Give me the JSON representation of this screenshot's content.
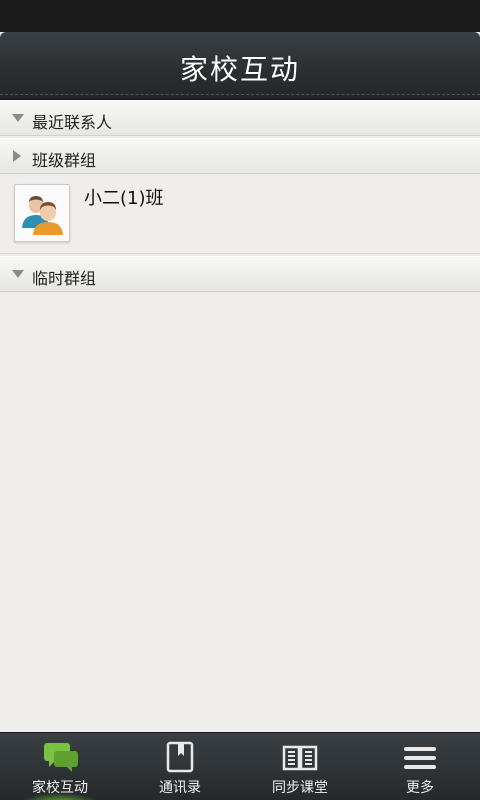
{
  "header": {
    "title": "家校互动"
  },
  "groups": [
    {
      "label": "最近联系人",
      "expanded": true
    },
    {
      "label": "班级群组",
      "expanded": false
    },
    {
      "label": "临时群组",
      "expanded": true
    }
  ],
  "contacts": [
    {
      "name": "小二(1)班",
      "icon": "group-avatar-icon"
    }
  ],
  "tabs": [
    {
      "label": "家校互动",
      "icon": "chat-bubbles-icon",
      "active": true
    },
    {
      "label": "通讯录",
      "icon": "address-book-icon",
      "active": false
    },
    {
      "label": "同步课堂",
      "icon": "open-book-icon",
      "active": false
    },
    {
      "label": "更多",
      "icon": "menu-icon",
      "active": false
    }
  ],
  "colors": {
    "active_tab": "#7ac142",
    "title_bar": "#2e3236",
    "background": "#efeeec"
  }
}
